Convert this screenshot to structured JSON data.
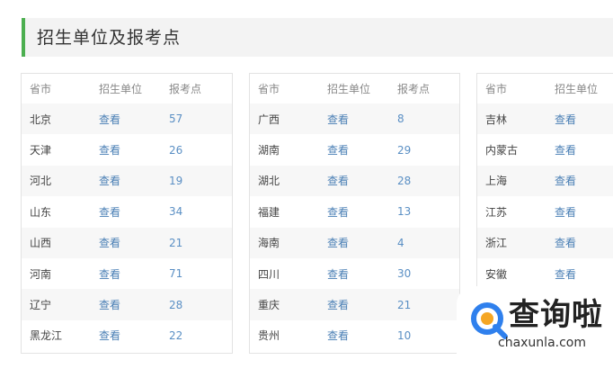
{
  "header": {
    "title": "招生单位及报考点"
  },
  "columns": {
    "province": "省市",
    "unit": "招生单位",
    "points": "报考点"
  },
  "panels": [
    {
      "rows": [
        {
          "province": "北京",
          "unit": "查看",
          "points": "57"
        },
        {
          "province": "天津",
          "unit": "查看",
          "points": "26"
        },
        {
          "province": "河北",
          "unit": "查看",
          "points": "19"
        },
        {
          "province": "山东",
          "unit": "查看",
          "points": "34"
        },
        {
          "province": "山西",
          "unit": "查看",
          "points": "21"
        },
        {
          "province": "河南",
          "unit": "查看",
          "points": "71"
        },
        {
          "province": "辽宁",
          "unit": "查看",
          "points": "28"
        },
        {
          "province": "黑龙江",
          "unit": "查看",
          "points": "22"
        }
      ]
    },
    {
      "rows": [
        {
          "province": "广西",
          "unit": "查看",
          "points": "8"
        },
        {
          "province": "湖南",
          "unit": "查看",
          "points": "29"
        },
        {
          "province": "湖北",
          "unit": "查看",
          "points": "28"
        },
        {
          "province": "福建",
          "unit": "查看",
          "points": "13"
        },
        {
          "province": "海南",
          "unit": "查看",
          "points": "4"
        },
        {
          "province": "四川",
          "unit": "查看",
          "points": "30"
        },
        {
          "province": "重庆",
          "unit": "查看",
          "points": "21"
        },
        {
          "province": "贵州",
          "unit": "查看",
          "points": "10"
        }
      ]
    },
    {
      "rows": [
        {
          "province": "吉林",
          "unit": "查看"
        },
        {
          "province": "内蒙古",
          "unit": "查看"
        },
        {
          "province": "上海",
          "unit": "查看"
        },
        {
          "province": "江苏",
          "unit": "查看"
        },
        {
          "province": "浙江",
          "unit": "查看"
        },
        {
          "province": "安徽",
          "unit": "查看"
        }
      ]
    }
  ],
  "watermark": {
    "brand": "查询啦",
    "domain": "chaxunla.com"
  },
  "colors": {
    "accent": "#4caf50",
    "link": "#4a7fb5",
    "number": "#5a8fc4",
    "stripe": "#f7f7f7"
  }
}
